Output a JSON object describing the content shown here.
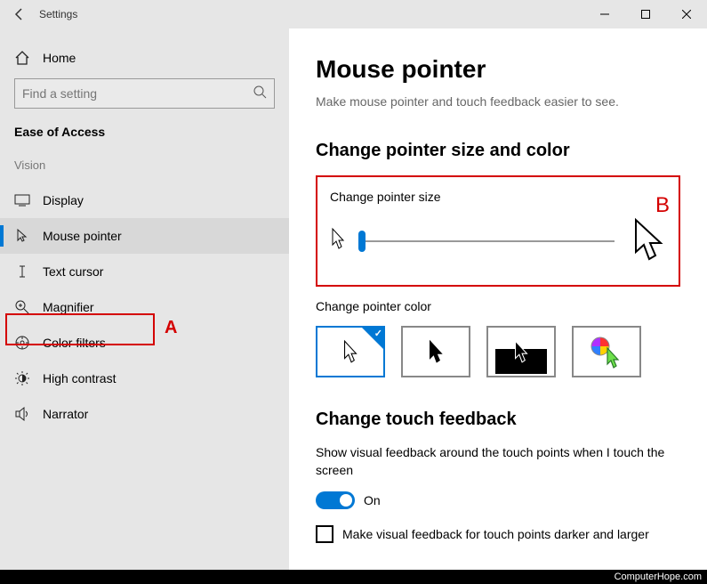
{
  "header": {
    "title": "Settings"
  },
  "sidebar": {
    "home_label": "Home",
    "search_placeholder": "Find a setting",
    "section_title": "Ease of Access",
    "group_label": "Vision",
    "items": [
      {
        "label": "Display"
      },
      {
        "label": "Mouse pointer"
      },
      {
        "label": "Text cursor"
      },
      {
        "label": "Magnifier"
      },
      {
        "label": "Color filters"
      },
      {
        "label": "High contrast"
      },
      {
        "label": "Narrator"
      }
    ]
  },
  "main": {
    "title": "Mouse pointer",
    "subtitle": "Make mouse pointer and touch feedback easier to see.",
    "size_section": "Change pointer size and color",
    "size_label": "Change pointer size",
    "color_label": "Change pointer color",
    "touch_section": "Change touch feedback",
    "touch_desc": "Show visual feedback around the touch points when I touch the screen",
    "toggle_state": "On",
    "check_label": "Make visual feedback for touch points darker and larger"
  },
  "annotations": {
    "A": "A",
    "B": "B"
  },
  "footer": "ComputerHope.com"
}
